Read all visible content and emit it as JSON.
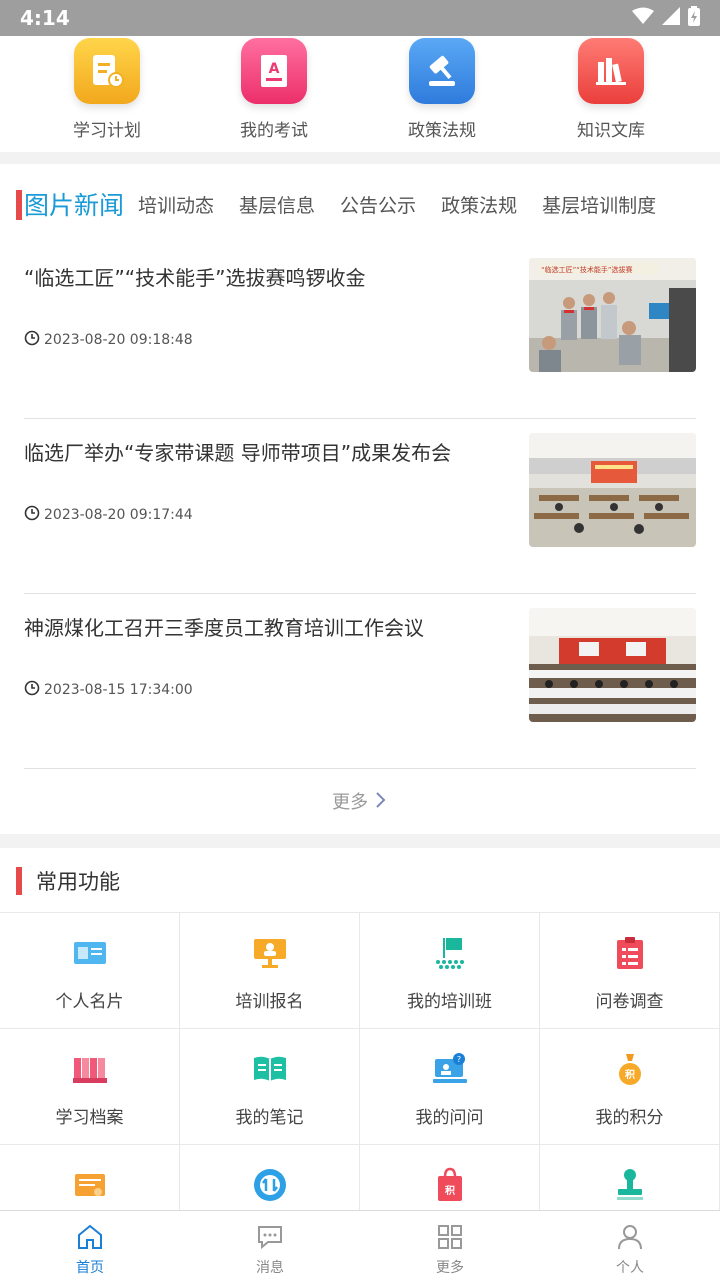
{
  "status": {
    "time": "4:14"
  },
  "quick": [
    {
      "label": "学习计划",
      "icon": "study-plan-icon",
      "color": "#f3b829"
    },
    {
      "label": "我的考试",
      "icon": "exam-icon",
      "color": "#f0457a"
    },
    {
      "label": "政策法规",
      "icon": "gavel-icon",
      "color": "#3c8fe8"
    },
    {
      "label": "知识文库",
      "icon": "library-icon",
      "color": "#f05a55"
    }
  ],
  "news": {
    "tabs": [
      "图片新闻",
      "培训动态",
      "基层信息",
      "公告公示",
      "政策法规",
      "基层培训制度"
    ],
    "items": [
      {
        "title": "“临选工匠”“技术能手”选拔赛鸣锣收金",
        "time": "2023-08-20 09:18:48"
      },
      {
        "title": "临选厂举办“专家带课题 导师带项目”成果发布会",
        "time": "2023-08-20 09:17:44"
      },
      {
        "title": "神源煤化工召开三季度员工教育培训工作会议",
        "time": "2023-08-15 17:34:00"
      }
    ],
    "more": "更多"
  },
  "common": {
    "title": "常用功能",
    "items": [
      {
        "label": "个人名片",
        "icon": "business-card-icon"
      },
      {
        "label": "培训报名",
        "icon": "training-signup-icon"
      },
      {
        "label": "我的培训班",
        "icon": "training-class-icon"
      },
      {
        "label": "问卷调查",
        "icon": "questionnaire-icon"
      },
      {
        "label": "学习档案",
        "icon": "study-archive-icon"
      },
      {
        "label": "我的笔记",
        "icon": "notes-icon"
      },
      {
        "label": "我的问问",
        "icon": "qa-icon"
      },
      {
        "label": "我的积分",
        "icon": "points-icon"
      },
      {
        "label": "",
        "icon": "certificate-icon"
      },
      {
        "label": "",
        "icon": "exchange-icon"
      },
      {
        "label": "",
        "icon": "shop-bag-icon"
      },
      {
        "label": "",
        "icon": "stamp-icon"
      }
    ]
  },
  "tabbar": [
    {
      "label": "首页",
      "icon": "home-icon",
      "active": true
    },
    {
      "label": "消息",
      "icon": "message-icon",
      "active": false
    },
    {
      "label": "更多",
      "icon": "grid-icon",
      "active": false
    },
    {
      "label": "个人",
      "icon": "person-icon",
      "active": false
    }
  ]
}
